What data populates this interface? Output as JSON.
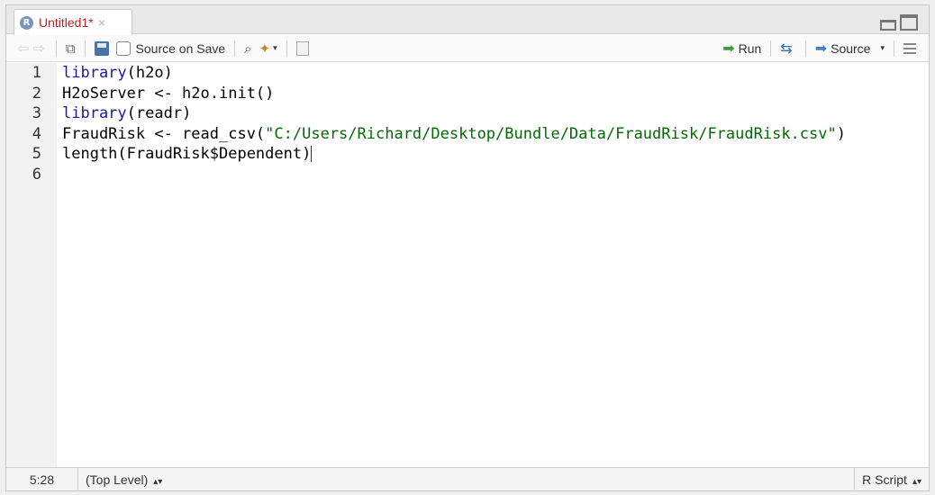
{
  "tab": {
    "label": "Untitled1*",
    "close": "×",
    "r_letter": "R"
  },
  "toolbar": {
    "source_on_save": "Source on Save",
    "run": "Run",
    "source": "Source"
  },
  "editor": {
    "line_numbers": [
      "1",
      "2",
      "3",
      "4",
      "5",
      "6"
    ],
    "lines": [
      {
        "kw": "library",
        "rest": "(h2o)"
      },
      {
        "text": "H2oServer <- h2o.init()"
      },
      {
        "kw": "library",
        "rest": "(readr)"
      },
      {
        "pre": "FraudRisk <- read_csv(",
        "str": "\"C:/Users/Richard/Desktop/Bundle/Data/FraudRisk/FraudRisk.csv\"",
        "post": ")"
      },
      {
        "text": "length(FraudRisk$Dependent)"
      },
      {
        "text": ""
      }
    ]
  },
  "status": {
    "cursor_pos": "5:28",
    "scope": "(Top Level)",
    "file_type": "R Script"
  },
  "colors": {
    "keyword": "#1a1aa6",
    "string": "#036a07",
    "tab_title": "#b22222"
  }
}
